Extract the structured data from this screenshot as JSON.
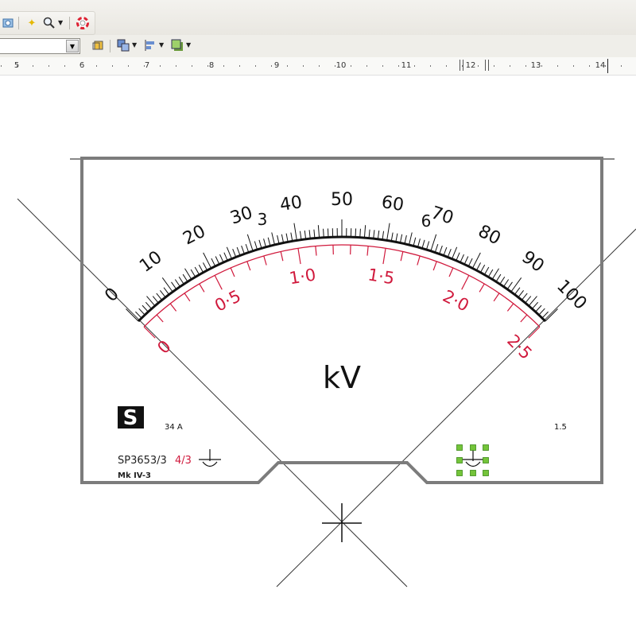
{
  "toolbar": {
    "icons": [
      "navigator-icon",
      "star-icon",
      "zoom-icon",
      "help-icon"
    ],
    "row2_icons": [
      "wrap-icon",
      "arrange-icon",
      "align-icon",
      "shadow-icon"
    ]
  },
  "font_combo": {
    "value": ""
  },
  "ruler": {
    "labels": [
      "5",
      "6",
      "7",
      "8",
      "9",
      "10",
      "11",
      "12",
      "13",
      "14"
    ]
  },
  "meter": {
    "scale_upper_labels": [
      "0",
      "10",
      "20",
      "30",
      "40",
      "50",
      "60",
      "70",
      "80",
      "90",
      "100"
    ],
    "scale_lower_labels": [
      "0",
      "0·5",
      "1·0",
      "1·5",
      "2·0",
      "2·5"
    ],
    "extra_labels": [
      "3",
      "6"
    ],
    "unit": "kV",
    "model_number": "SP3653/3",
    "fraction": "4/3",
    "variant": "Mk IV-3",
    "code_left": "34 A",
    "class_label": "1.5",
    "logo_letter": "S"
  },
  "colors": {
    "red_scale": "#d0193c",
    "frame": "#7c7c7c",
    "selection_handle": "#74c43a"
  }
}
